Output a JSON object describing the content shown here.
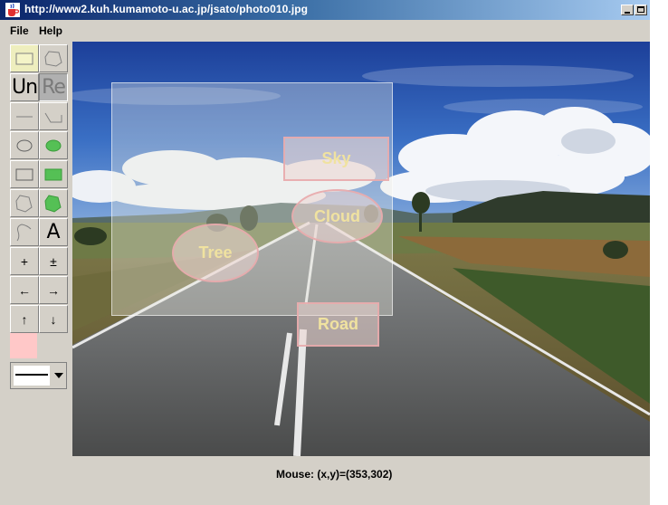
{
  "window": {
    "title": "http://www2.kuh.kumamoto-u.ac.jp/jsato/photo010.jpg"
  },
  "menu": {
    "items": [
      {
        "label": "File"
      },
      {
        "label": "Help"
      }
    ]
  },
  "toolbar": {
    "selected_tool": "select-rect",
    "undo_label": "Un",
    "redo_label": "Re",
    "text_tool_label": "A",
    "zoom_in_label": "+",
    "zoom_out_label": "±",
    "arrow_left": "←",
    "arrow_right": "→",
    "arrow_up": "↑",
    "arrow_down": "↓",
    "current_color": "#ffc8c8"
  },
  "labels": [
    {
      "text": "Sky",
      "shape": "rectangle"
    },
    {
      "text": "Cloud",
      "shape": "ellipse"
    },
    {
      "text": "Tree",
      "shape": "ellipse"
    },
    {
      "text": "Road",
      "shape": "rectangle"
    }
  ],
  "colors": {
    "label_text": "#f0e2a0",
    "label_border": "#e8aaac",
    "accent_fill": "#55c055"
  },
  "status": {
    "mouse": "Mouse: (x,y)=(353,302)"
  }
}
